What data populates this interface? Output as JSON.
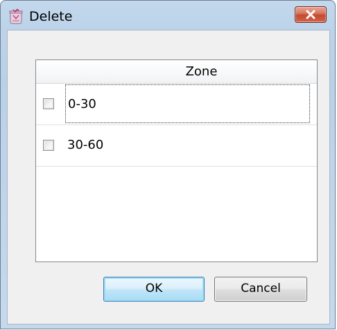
{
  "window": {
    "title": "Delete",
    "app_icon": "recycle-bin-icon",
    "close_icon": "close-icon"
  },
  "table": {
    "header": "Zone",
    "rows": [
      {
        "label": "0-30",
        "checked": false,
        "focused": true
      },
      {
        "label": "30-60",
        "checked": false,
        "focused": false
      }
    ]
  },
  "buttons": {
    "ok_label": "OK",
    "cancel_label": "Cancel"
  },
  "colors": {
    "title_bar": "#bcd3e9",
    "close_button": "#c24a2e",
    "ok_button": "#bfe5f8"
  }
}
